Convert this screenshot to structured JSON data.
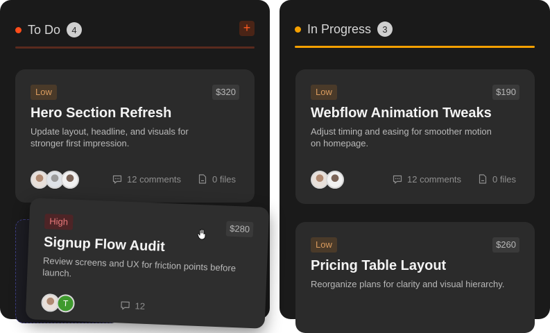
{
  "columns": {
    "todo": {
      "title": "To Do",
      "count": "4",
      "add_label": "+",
      "accent": "#ff4d1a",
      "underline": "#5a2a1e",
      "cards": [
        {
          "priority": "Low",
          "price": "$320",
          "title": "Hero Section Refresh",
          "desc": "Update layout, headline, and visuals for stronger first impression.",
          "comments": "12 comments",
          "files": "0 files"
        }
      ]
    },
    "progress": {
      "title": "In Progress",
      "count": "3",
      "accent": "#f5a000",
      "underline": "#f5a000",
      "cards": [
        {
          "priority": "Low",
          "price": "$190",
          "title": "Webflow Animation Tweaks",
          "desc": "Adjust timing and easing for smoother motion on homepage.",
          "comments": "12 comments",
          "files": "0 files"
        },
        {
          "priority": "Low",
          "price": "$260",
          "title": "Pricing Table Layout",
          "desc": "Reorganize plans for clarity and visual hierarchy."
        }
      ]
    }
  },
  "dragging_card": {
    "priority": "High",
    "price": "$280",
    "title": "Signup Flow Audit",
    "desc": "Review screens and UX for friction points before launch.",
    "avatar_initial": "T",
    "comments": "12"
  },
  "icons": {
    "comment": "comment-icon",
    "file": "file-icon",
    "cursor": "grab-hand-cursor-icon"
  }
}
